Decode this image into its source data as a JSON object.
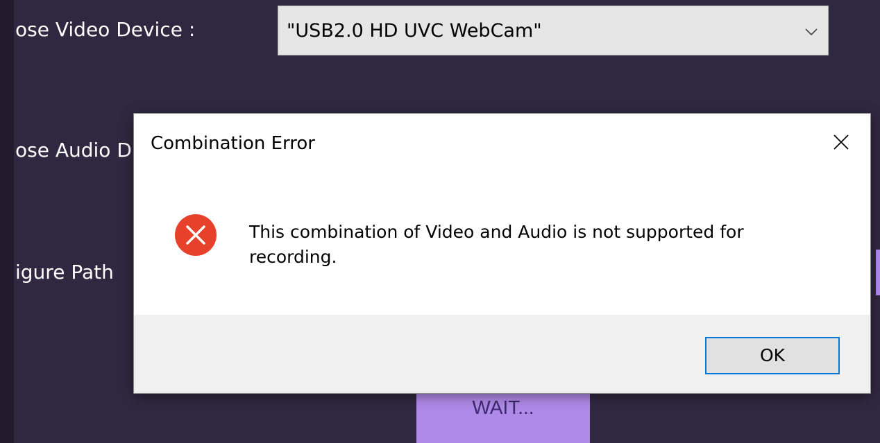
{
  "form": {
    "video_label": "ose Video Device :",
    "audio_label": "ose Audio D",
    "path_label": "igure Path",
    "video_select": {
      "value": "\"USB2.0 HD UVC WebCam\"",
      "icon": "chevron-down-icon"
    },
    "wait_button_label": "WAIT..."
  },
  "dialog": {
    "title": "Combination Error",
    "message": "This combination of Video and Audio is not supported for recording.",
    "ok_label": "OK",
    "icons": {
      "close": "close-icon",
      "error": "error-icon"
    }
  },
  "colors": {
    "background": "#302840",
    "button_accent": "#b08ae8",
    "error_red": "#e8412b",
    "focus_blue": "#0078d7"
  }
}
